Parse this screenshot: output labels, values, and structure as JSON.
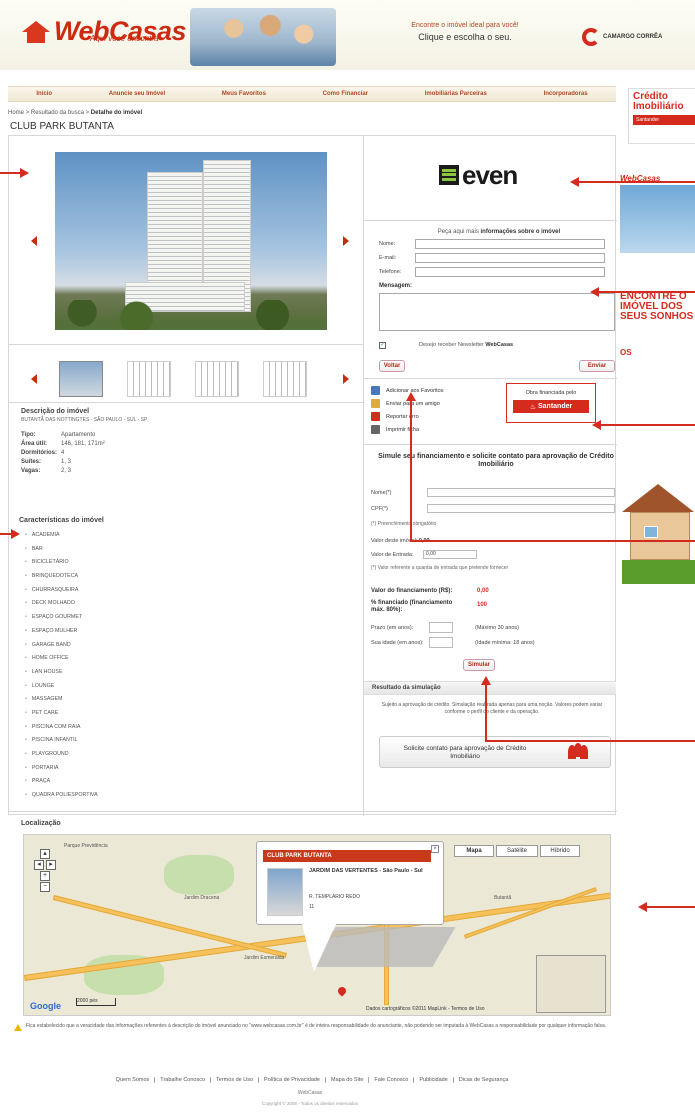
{
  "header": {
    "logo_text": "WebCasas",
    "logo_tagline": "Aqui você encontra",
    "promo_line1": "Encontre o imóvel ideal para você!",
    "promo_line2": "Clique e escolha o seu.",
    "partner_name": "CAMARGO CORRÊA"
  },
  "nav": {
    "items": [
      "Início",
      "Anuncie seu Imóvel",
      "Meus Favoritos",
      "Como Financiar",
      "Imobiliárias Parceiras",
      "Incorporadoras"
    ]
  },
  "breadcrumb": {
    "home": "Home",
    "sep1": ">",
    "results": "Resultado da busca",
    "sep2": ">",
    "current": "Detalhe do imóvel"
  },
  "page_title": "CLUB PARK BUTANTA",
  "property": {
    "description_title": "Descrição do imóvel",
    "address": "BUTANTÃ DAS NOTTINGTES - SÃO PAULO - SUL - SP",
    "specs": [
      {
        "key": "Tipo:",
        "value": "Apartamento"
      },
      {
        "key": "Área útil:",
        "value": "146, 181, 171m²"
      },
      {
        "key": "Dormitórios:",
        "value": "4"
      },
      {
        "key": "Suítes:",
        "value": "1, 3"
      },
      {
        "key": "Vagas:",
        "value": "2, 3"
      }
    ],
    "features_title": "Características do imóvel",
    "features": [
      "ACADEMIA",
      "BAR",
      "BICICLETÁRIO",
      "BRINQUEDOTECA",
      "CHURRASQUEIRA",
      "DECK MOLHADO",
      "ESPAÇO GOURMET",
      "ESPAÇO MULHER",
      "GARAGE BAND",
      "HOME OFFICE",
      "LAN HOUSE",
      "LOUNGE",
      "MASSAGEM",
      "PET CARE",
      "PISCINA COM RAIA",
      "PISCINA INFANTIL",
      "PLAYGROUND",
      "PORTARIA",
      "PRAÇA",
      "QUADRA POLIESPORTIVA"
    ]
  },
  "developer": {
    "name": "even"
  },
  "contact_form": {
    "title_prefix": "Peça aqui mais",
    "title_bold": "informações sobre o imóvel",
    "name_label": "Nome:",
    "email_label": "E-mail:",
    "phone_label": "Telefone:",
    "message_label": "Mensagem:",
    "newsletter_prefix": "Desejo receber Newsletter",
    "newsletter_brand": "WebCasas",
    "clear_label": "Voltar",
    "send_label": "Enviar"
  },
  "actions": [
    {
      "label": "Adicionar aos Favoritos",
      "icon": "favorites-icon",
      "color": "#4a78b8"
    },
    {
      "label": "Enviar para um amigo",
      "icon": "email-icon",
      "color": "#e3a93c"
    },
    {
      "label": "Reportar erro",
      "icon": "warning-icon",
      "color": "#d52b1e"
    },
    {
      "label": "Imprimir ficha",
      "icon": "print-icon",
      "color": "#666666"
    }
  ],
  "financing_badge": {
    "title": "Obra financiada pelo",
    "bank": "Santander"
  },
  "simulator": {
    "title": "Simule seu financiamento e solicite contato para aprovação de Crédito Imobiliário",
    "name_label": "Nome(*)",
    "cpf_label": "CPF(*)",
    "required_note": "(*) Preenchimento obrigatório",
    "property_value_label": "Valor deste imóvel:",
    "property_value": "0,00",
    "down_payment_label": "Valor de Entrada:",
    "down_payment_value": "0,00",
    "down_payment_note": "(*) Valor referente a quantia de entrada que pretende fornecer",
    "financing_value_label": "Valor do financiamento (R$):",
    "financing_value": "0,00",
    "financed_pct_label": "% financiado (financiamento máx. 80%):",
    "financed_pct": "100",
    "term_label": "Prazo (em anos):",
    "term_hint": "(Máximo 30 anos)",
    "age_label": "Sua idade (em anos):",
    "age_hint": "(Idade mínima: 18 anos)",
    "simulate_label": "Simular",
    "result_title": "Resultado da simulação",
    "result_text": "Sujeito a aprovação de crédito. Simulação realizada apenas para uma noção. Valores podem variar conforme o perfil do cliente e da operação.",
    "contact_label": "Solicite contato para aprovação de Crédito Imobiliário"
  },
  "map": {
    "section_title": "Localização",
    "type_buttons": [
      "Mapa",
      "Satélite",
      "Híbrido"
    ],
    "info_title": "CLUB PARK BUTANTA",
    "info_line1": "JARDIM DAS VERTENTES - São Paulo - Sul",
    "info_line2": "R. TEMPLÁRIO REDO",
    "info_line3": "11",
    "scale_label": "2000 pés",
    "copyright": "Dados cartográficos ©2011 MapLink - Termos de Uso",
    "google": "Google",
    "area_labels": [
      "Parque Previdência",
      "Jardim Esmeralda",
      "Jardim Dracena",
      "Butantã"
    ]
  },
  "disclaimer": "Fica estabelecido que a veracidade das informações referentes à descrição do imóvel anunciado no \"www.webcasas.com.br\" é de inteira responsabilidade do anunciante, não podendo ser imputada à WebCasas a responsabilidade por qualquer informação falsa.",
  "footer": {
    "links": [
      "Quem Somos",
      "Trabalhe Conosco",
      "Termos de Uso",
      "Política de Privacidade",
      "Mapa do Site",
      "Fale Conosco",
      "Publicidade",
      "Dicas de Segurança"
    ],
    "brand": "WebCasas",
    "copyright": "Copyright © 2008 - Todos os direitos reservados"
  },
  "sidebar_ads": {
    "credito_title": "Crédito Imobiliário",
    "credito_bank": "Santander",
    "webcasas": "WebCasas",
    "encontre": "ENCONTRE O IMÓVEL DOS SEUS SONHOS",
    "os": "OS"
  },
  "colors": {
    "brand_red": "#cc2a12",
    "santander_red": "#d52b1e",
    "nav_text": "#b04523"
  }
}
